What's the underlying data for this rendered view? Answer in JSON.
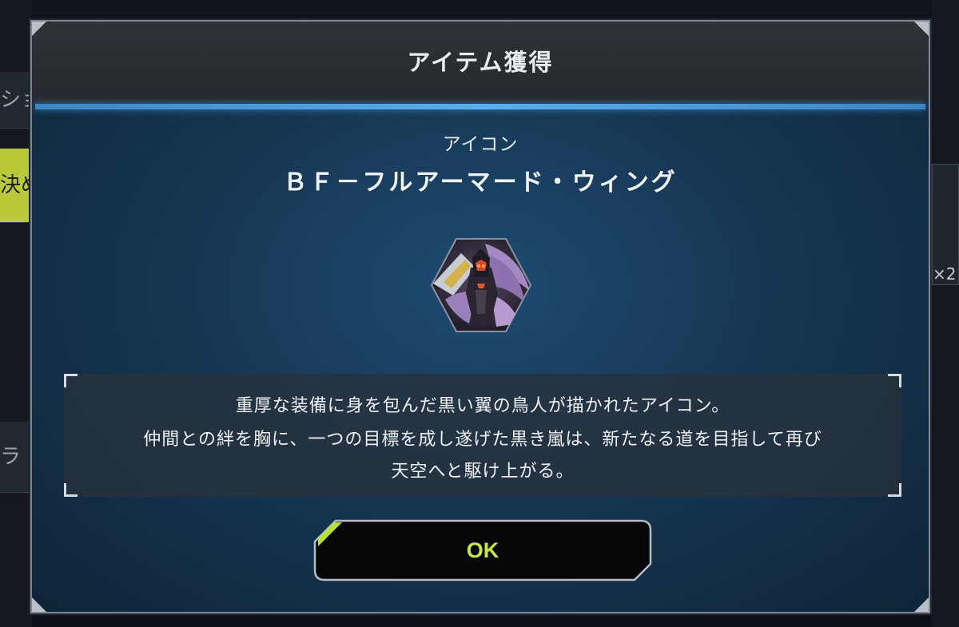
{
  "dialog": {
    "title": "アイテム獲得",
    "item_type": "アイコン",
    "item_name": "ＢＦ－フルアーマード・ウィング",
    "item_icon": "bf-full-armored-wing-icon",
    "description": [
      "重厚な装備に身を包んだ黒い翼の鳥人が描かれたアイコン。",
      "仲間との絆を胸に、一つの目標を成し遂げた黒き嵐は、新たなる道を目指して再び",
      "天空へと駆け上がる。"
    ],
    "ok_label": "OK"
  },
  "background": {
    "left_strips": [
      "ショ",
      "決め",
      "ラ"
    ],
    "right_badge": "×2"
  },
  "colors": {
    "accent_line": "#58aef0",
    "ok_text": "#c8ea3a",
    "panel_blue": "#1f4a72"
  }
}
